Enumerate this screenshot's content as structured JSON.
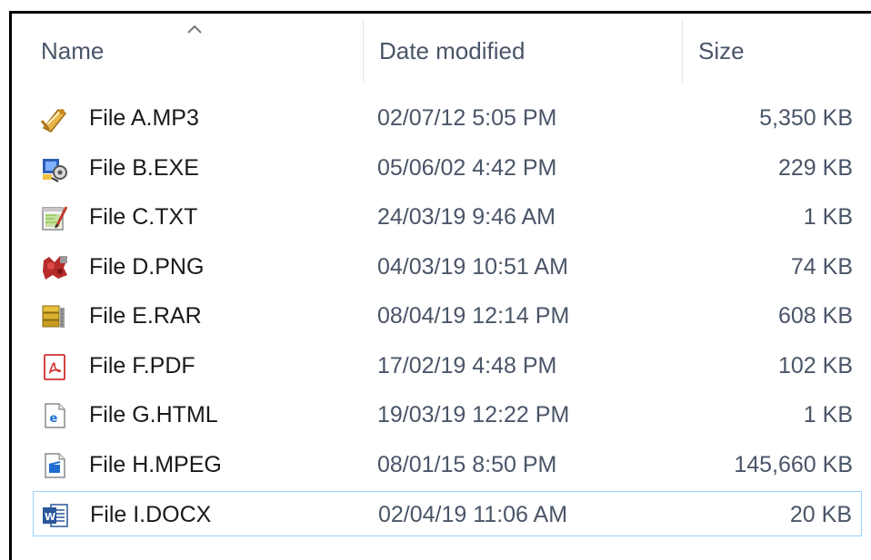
{
  "columns": {
    "name": "Name",
    "date": "Date modified",
    "size": "Size"
  },
  "sort": {
    "column": "name",
    "direction": "ascending"
  },
  "colors": {
    "selection_border": "#99d1ff",
    "header_text": "#4a5568"
  },
  "files": [
    {
      "name": "File A.MP3",
      "date": "02/07/12 5:05 PM",
      "size": "5,350 KB",
      "icon": "audio-file-icon"
    },
    {
      "name": "File B.EXE",
      "date": "05/06/02 4:42 PM",
      "size": "229 KB",
      "icon": "exe-file-icon"
    },
    {
      "name": "File C.TXT",
      "date": "24/03/19 9:46 AM",
      "size": "1 KB",
      "icon": "text-file-icon"
    },
    {
      "name": "File D.PNG",
      "date": "04/03/19 10:51 AM",
      "size": "74 KB",
      "icon": "image-file-icon"
    },
    {
      "name": "File E.RAR",
      "date": "08/04/19 12:14 PM",
      "size": "608 KB",
      "icon": "archive-file-icon"
    },
    {
      "name": "File F.PDF",
      "date": "17/02/19 4:48 PM",
      "size": "102 KB",
      "icon": "pdf-file-icon"
    },
    {
      "name": "File G.HTML",
      "date": "19/03/19 12:22 PM",
      "size": "1 KB",
      "icon": "html-file-icon"
    },
    {
      "name": "File H.MPEG",
      "date": "08/01/15 8:50 PM",
      "size": "145,660 KB",
      "icon": "video-file-icon"
    },
    {
      "name": "File I.DOCX",
      "date": "02/04/19 11:06 AM",
      "size": "20 KB",
      "icon": "word-file-icon",
      "selected": true
    }
  ]
}
